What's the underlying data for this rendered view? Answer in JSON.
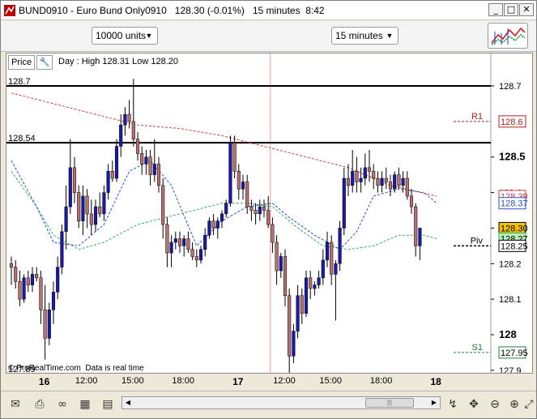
{
  "window": {
    "title": "BUND0910 - Euro Bund Only0910",
    "price": "128.30 (-0.01%)",
    "interval": "15 minutes",
    "time": "8:42",
    "controls": {
      "minimize": "_",
      "maximize": "□",
      "close": "✕"
    }
  },
  "toolbar": {
    "units_value": "10000 units",
    "timeframe_value": "15 minutes",
    "chart_icon": "chart-type-icon"
  },
  "panel": {
    "price_button": "Price",
    "info": "Day : High 128.31 Low 128.20",
    "copyright": "© ProRealTime.com  Data is real time"
  },
  "levels": {
    "top_label": "128.7",
    "upper_label": "128.54",
    "bottom_label": "127.89",
    "r1_label": "R1",
    "r1_value": "128.6",
    "piv_label": "Piv",
    "s1_label": "S1",
    "s1_value": "127.95",
    "ma_red_value": "128.39",
    "ma_blue_value": "128.37",
    "last_price": "128.30",
    "ma_green_value": "128.27",
    "piv_value": "128.25"
  },
  "colors": {
    "bull": "#1a1aa6",
    "bear": "#b87070",
    "ma_red": "#d04040",
    "ma_blue": "#2a4fd0",
    "ma_green": "#30b060",
    "last_price_bg": "#f2c200",
    "r1": "#b02020",
    "s1": "#208040"
  },
  "chart_data": {
    "type": "candlestick",
    "title": "BUND0910 - Euro Bund Only0910",
    "ylim": [
      127.86,
      128.76
    ],
    "y_ticks": [
      128.7,
      128.5,
      128.4,
      128.3,
      128.2,
      128.1,
      128.0,
      127.9
    ],
    "y_tick_labels": [
      "128.7",
      "128.5",
      "128.4",
      "128.3",
      "128.2",
      "128.1",
      "128",
      "127.9"
    ],
    "bold_ticks": [
      "128.5",
      "128"
    ],
    "x_labels": [
      {
        "label": "16",
        "bar": 8,
        "bold": true
      },
      {
        "label": "12:00",
        "bar": 18,
        "bold": false
      },
      {
        "label": "15:00",
        "bar": 29,
        "bold": false
      },
      {
        "label": "18:00",
        "bar": 41,
        "bold": false
      },
      {
        "label": "17",
        "bar": 54,
        "bold": true
      },
      {
        "label": "12:00",
        "bar": 65,
        "bold": false
      },
      {
        "label": "15:00",
        "bar": 76,
        "bold": false
      },
      {
        "label": "18:00",
        "bar": 88,
        "bold": false
      },
      {
        "label": "18",
        "bar": 101,
        "bold": true
      }
    ],
    "session_separator_bar": 61.5,
    "hlines": [
      {
        "value": 128.7,
        "style": "solid",
        "label": "128.7"
      },
      {
        "value": 128.54,
        "style": "solid",
        "label": "128.54"
      },
      {
        "value": 127.89,
        "style": "solid",
        "label": "127.89"
      }
    ],
    "pivots": {
      "R1": 128.6,
      "Piv": 128.25,
      "S1": 127.95
    },
    "candles_ohlc": [
      [
        128.2,
        128.22,
        128.14,
        128.19
      ],
      [
        128.19,
        128.21,
        128.13,
        128.15
      ],
      [
        128.15,
        128.18,
        128.08,
        128.1
      ],
      [
        128.1,
        128.17,
        128.09,
        128.16
      ],
      [
        128.16,
        128.18,
        128.12,
        128.14
      ],
      [
        128.14,
        128.19,
        128.12,
        128.17
      ],
      [
        128.17,
        128.19,
        128.15,
        128.16
      ],
      [
        128.16,
        128.18,
        128.03,
        128.07
      ],
      [
        128.07,
        128.14,
        127.93,
        127.99
      ],
      [
        127.99,
        128.09,
        127.97,
        128.07
      ],
      [
        128.07,
        128.15,
        128.03,
        128.12
      ],
      [
        128.12,
        128.22,
        128.1,
        128.19
      ],
      [
        128.19,
        128.31,
        128.17,
        128.29
      ],
      [
        128.29,
        128.42,
        128.24,
        128.36
      ],
      [
        128.36,
        128.55,
        128.34,
        128.47
      ],
      [
        128.47,
        128.5,
        128.37,
        128.4
      ],
      [
        128.4,
        128.42,
        128.3,
        128.32
      ],
      [
        128.32,
        128.42,
        128.28,
        128.39
      ],
      [
        128.39,
        128.41,
        128.3,
        128.34
      ],
      [
        128.34,
        128.38,
        128.28,
        128.31
      ],
      [
        128.31,
        128.38,
        128.29,
        128.36
      ],
      [
        128.36,
        128.4,
        128.33,
        128.34
      ],
      [
        128.34,
        128.42,
        128.32,
        128.4
      ],
      [
        128.4,
        128.48,
        128.38,
        128.46
      ],
      [
        128.46,
        128.49,
        128.43,
        128.44
      ],
      [
        128.44,
        128.55,
        128.43,
        128.53
      ],
      [
        128.53,
        128.62,
        128.5,
        128.59
      ],
      [
        128.59,
        128.64,
        128.56,
        128.62
      ],
      [
        128.62,
        128.66,
        128.58,
        128.6
      ],
      [
        128.6,
        128.72,
        128.53,
        128.55
      ],
      [
        128.55,
        128.57,
        128.49,
        128.51
      ],
      [
        128.51,
        128.53,
        128.45,
        128.48
      ],
      [
        128.48,
        128.52,
        128.45,
        128.5
      ],
      [
        128.5,
        128.52,
        128.42,
        128.45
      ],
      [
        128.45,
        128.55,
        128.43,
        128.48
      ],
      [
        128.48,
        128.5,
        128.4,
        128.42
      ],
      [
        128.42,
        128.44,
        128.27,
        128.31
      ],
      [
        128.31,
        128.33,
        128.19,
        128.23
      ],
      [
        128.23,
        128.28,
        128.19,
        128.26
      ],
      [
        128.26,
        128.29,
        128.24,
        128.27
      ],
      [
        128.27,
        128.29,
        128.23,
        128.25
      ],
      [
        128.25,
        128.28,
        128.22,
        128.27
      ],
      [
        128.27,
        128.29,
        128.23,
        128.24
      ],
      [
        128.24,
        128.26,
        128.21,
        128.22
      ],
      [
        128.22,
        128.24,
        128.19,
        128.21
      ],
      [
        128.21,
        128.25,
        128.2,
        128.24
      ],
      [
        128.24,
        128.3,
        128.22,
        128.28
      ],
      [
        128.28,
        128.33,
        128.27,
        128.32
      ],
      [
        128.32,
        128.34,
        128.28,
        128.3
      ],
      [
        128.3,
        128.33,
        128.27,
        128.32
      ],
      [
        128.32,
        128.35,
        128.3,
        128.34
      ],
      [
        128.34,
        128.38,
        128.33,
        128.37
      ],
      [
        128.37,
        128.56,
        128.36,
        128.54
      ],
      [
        128.54,
        128.56,
        128.44,
        128.46
      ],
      [
        128.46,
        128.48,
        128.38,
        128.41
      ],
      [
        128.41,
        128.45,
        128.38,
        128.43
      ],
      [
        128.43,
        128.45,
        128.34,
        128.36
      ],
      [
        128.36,
        128.38,
        128.32,
        128.35
      ],
      [
        128.35,
        128.37,
        128.31,
        128.34
      ],
      [
        128.34,
        128.38,
        128.32,
        128.36
      ],
      [
        128.36,
        128.38,
        128.33,
        128.35
      ],
      [
        128.35,
        128.39,
        128.3,
        128.31
      ],
      [
        128.31,
        128.33,
        128.23,
        128.26
      ],
      [
        128.26,
        128.28,
        128.14,
        128.18
      ],
      [
        128.18,
        128.23,
        128.16,
        128.22
      ],
      [
        128.22,
        128.24,
        128.08,
        128.11
      ],
      [
        128.11,
        128.13,
        127.88,
        127.94
      ],
      [
        127.94,
        128.03,
        127.92,
        128.01
      ],
      [
        128.01,
        128.14,
        127.99,
        128.11
      ],
      [
        128.11,
        128.13,
        128.03,
        128.06
      ],
      [
        128.06,
        128.18,
        128.05,
        128.16
      ],
      [
        128.16,
        128.18,
        128.1,
        128.13
      ],
      [
        128.13,
        128.15,
        128.11,
        128.14
      ],
      [
        128.14,
        128.18,
        128.13,
        128.16
      ],
      [
        128.16,
        128.24,
        128.14,
        128.21
      ],
      [
        128.21,
        128.29,
        128.19,
        128.26
      ],
      [
        128.26,
        128.28,
        128.14,
        128.17
      ],
      [
        128.17,
        128.21,
        128.04,
        128.2
      ],
      [
        128.2,
        128.32,
        128.18,
        128.3
      ],
      [
        128.3,
        128.47,
        128.28,
        128.44
      ],
      [
        128.44,
        128.48,
        128.39,
        128.42
      ],
      [
        128.42,
        128.52,
        128.4,
        128.46
      ],
      [
        128.46,
        128.5,
        128.4,
        128.43
      ],
      [
        128.43,
        128.47,
        128.4,
        128.44
      ],
      [
        128.44,
        128.51,
        128.42,
        128.47
      ],
      [
        128.47,
        128.52,
        128.43,
        128.46
      ],
      [
        128.46,
        128.48,
        128.41,
        128.44
      ],
      [
        128.44,
        128.46,
        128.4,
        128.42
      ],
      [
        128.42,
        128.46,
        128.4,
        128.44
      ],
      [
        128.44,
        128.47,
        128.41,
        128.43
      ],
      [
        128.43,
        128.45,
        128.39,
        128.41
      ],
      [
        128.41,
        128.46,
        128.4,
        128.45
      ],
      [
        128.45,
        128.47,
        128.41,
        128.42
      ],
      [
        128.42,
        128.46,
        128.4,
        128.44
      ],
      [
        128.44,
        128.46,
        128.38,
        128.39
      ],
      [
        128.39,
        128.41,
        128.34,
        128.36
      ],
      [
        128.36,
        128.37,
        128.22,
        128.25
      ],
      [
        128.25,
        128.3,
        128.21,
        128.3
      ]
    ],
    "ma_red": [
      [
        0,
        128.68
      ],
      [
        10,
        128.65
      ],
      [
        20,
        128.62
      ],
      [
        30,
        128.59
      ],
      [
        40,
        128.58
      ],
      [
        50,
        128.56
      ],
      [
        60,
        128.53
      ],
      [
        70,
        128.5
      ],
      [
        80,
        128.47
      ],
      [
        90,
        128.42
      ],
      [
        101,
        128.39
      ]
    ],
    "ma_blue": [
      [
        0,
        128.49
      ],
      [
        6,
        128.36
      ],
      [
        10,
        128.26
      ],
      [
        16,
        128.25
      ],
      [
        22,
        128.31
      ],
      [
        28,
        128.46
      ],
      [
        33,
        128.49
      ],
      [
        38,
        128.42
      ],
      [
        44,
        128.25
      ],
      [
        50,
        128.32
      ],
      [
        56,
        128.36
      ],
      [
        62,
        128.37
      ],
      [
        66,
        128.33
      ],
      [
        72,
        128.28
      ],
      [
        78,
        128.24
      ],
      [
        82,
        128.29
      ],
      [
        86,
        128.39
      ],
      [
        92,
        128.41
      ],
      [
        98,
        128.4
      ],
      [
        101,
        128.37
      ]
    ],
    "ma_green": [
      [
        0,
        128.46
      ],
      [
        6,
        128.36
      ],
      [
        10,
        128.28
      ],
      [
        16,
        128.24
      ],
      [
        22,
        128.26
      ],
      [
        30,
        128.31
      ],
      [
        40,
        128.34
      ],
      [
        50,
        128.37
      ],
      [
        56,
        128.37
      ],
      [
        62,
        128.36
      ],
      [
        68,
        128.3
      ],
      [
        74,
        128.25
      ],
      [
        80,
        128.24
      ],
      [
        86,
        128.25
      ],
      [
        92,
        128.28
      ],
      [
        98,
        128.28
      ],
      [
        101,
        128.27
      ]
    ]
  },
  "bottom": {
    "icons": [
      "mail-icon",
      "print-icon",
      "binoculars-icon",
      "calculator-icon",
      "chart-list-icon",
      "indicator-icon",
      "crosshair-icon",
      "zoom-out-icon",
      "zoom-in-icon",
      "fit-icon"
    ]
  }
}
